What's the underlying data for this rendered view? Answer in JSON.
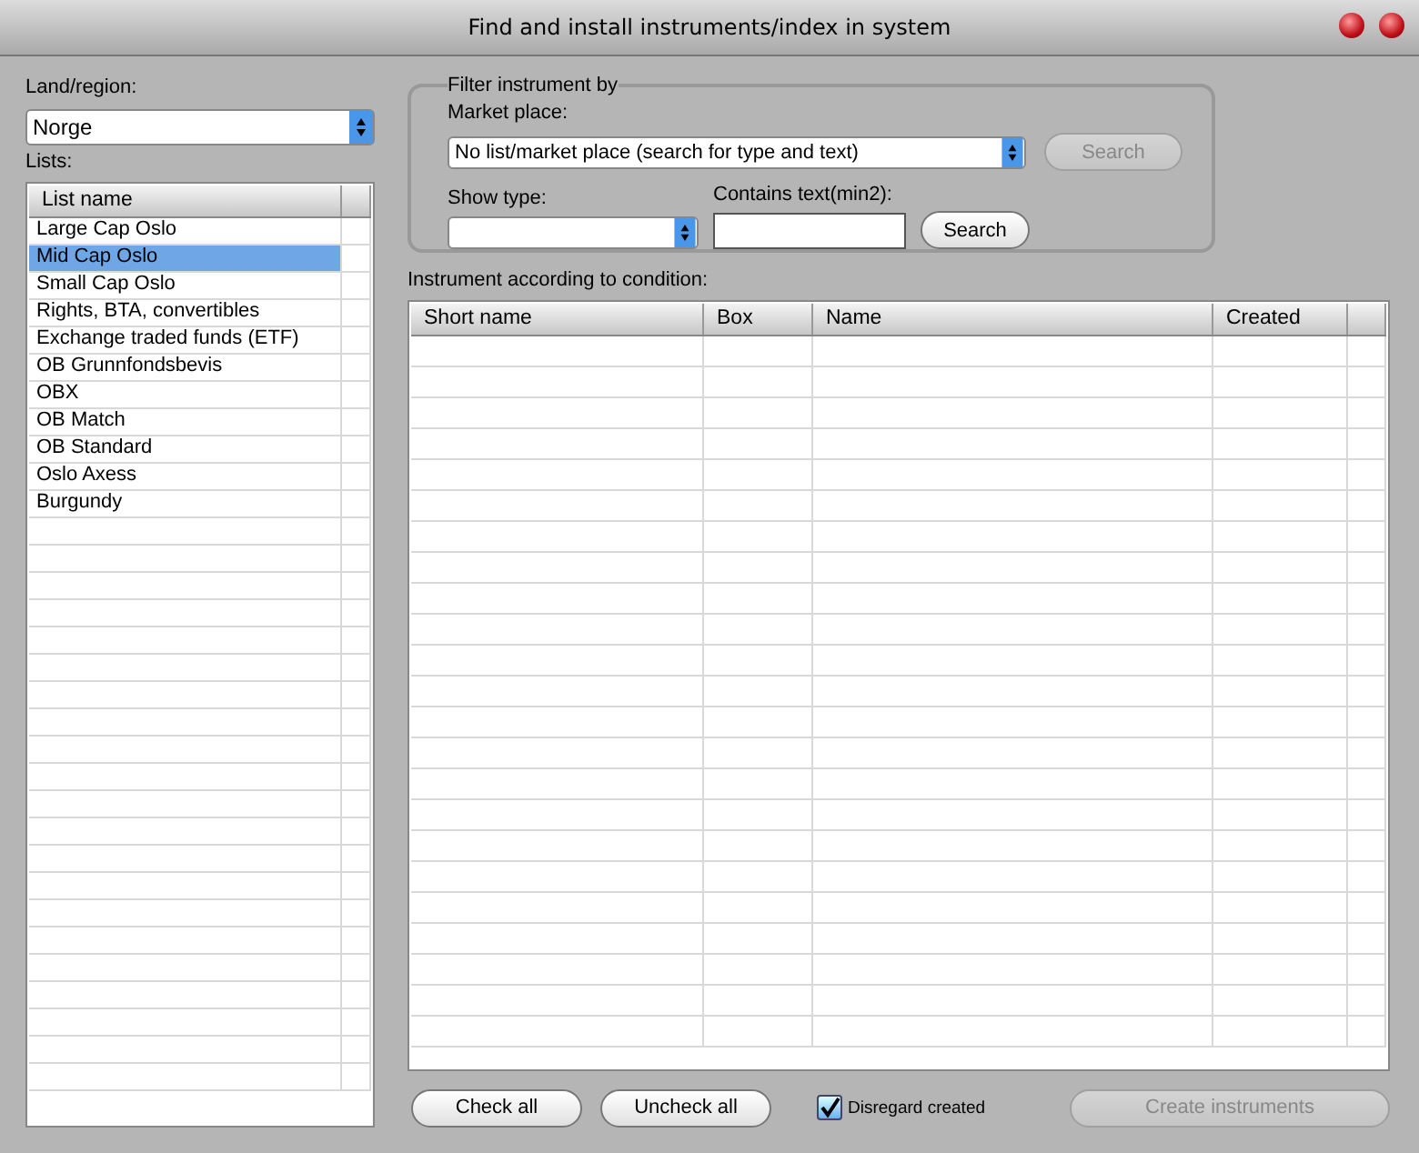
{
  "window": {
    "title": "Find and install instruments/index in system"
  },
  "region": {
    "label": "Land/region:",
    "value": "Norge"
  },
  "lists": {
    "label": "Lists:",
    "column": "List name",
    "items": [
      {
        "name": "Large Cap Oslo",
        "selected": false
      },
      {
        "name": "Mid Cap Oslo",
        "selected": true
      },
      {
        "name": "Small Cap Oslo",
        "selected": false
      },
      {
        "name": "Rights, BTA, convertibles",
        "selected": false
      },
      {
        "name": "Exchange traded funds (ETF)",
        "selected": false
      },
      {
        "name": "OB Grunnfondsbevis",
        "selected": false
      },
      {
        "name": "OBX",
        "selected": false
      },
      {
        "name": "OB Match",
        "selected": false
      },
      {
        "name": "OB Standard",
        "selected": false
      },
      {
        "name": "Oslo Axess",
        "selected": false
      },
      {
        "name": "Burgundy",
        "selected": false
      }
    ]
  },
  "filter": {
    "title": "Filter instrument by",
    "market_label": "Market place:",
    "market_value": "No list/market place (search for type and text)",
    "market_search": {
      "label": "Search",
      "disabled": true
    },
    "type_label": "Show type:",
    "text_label": "Contains text(min2):",
    "text_search": {
      "label": "Search",
      "disabled": false
    }
  },
  "instruments": {
    "label": "Instrument according to condition:",
    "columns": [
      "Short name",
      "Box",
      "Name",
      "Created"
    ]
  },
  "footer": {
    "check_all": "Check all",
    "uncheck_all": "Uncheck all",
    "disregard": {
      "label": "Disregard created",
      "checked": true
    },
    "create": {
      "label": "Create instruments",
      "disabled": true
    }
  }
}
